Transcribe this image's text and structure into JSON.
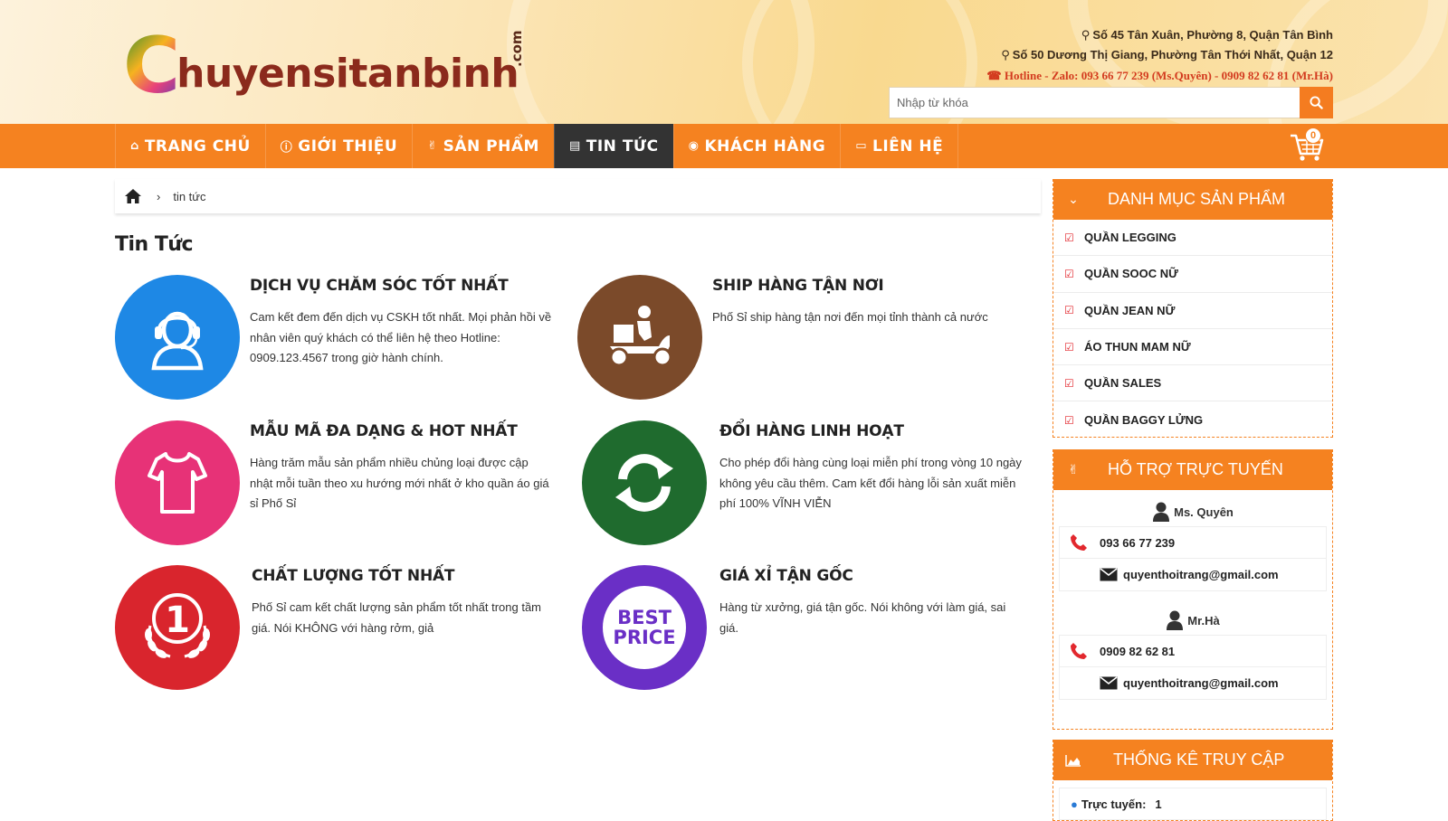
{
  "header": {
    "logo": {
      "letter": "C",
      "text": "huyensitanbinh",
      "tld": ".com"
    },
    "address_1": "Số 45 Tân Xuân, Phường 8, Quận Tân Bình",
    "address_2": "Số 50 Dương Thị Giang, Phường Tân Thới Nhất, Quận 12",
    "hotline": "Hotline - Zalo: 093 66 77 239 (Ms.Quyên) - 0909 82 62 81 (Mr.Hà)",
    "search": {
      "placeholder": "Nhập từ khóa",
      "value": ""
    }
  },
  "nav": {
    "items": [
      {
        "label": "TRANG CHỦ",
        "icon": "home-icon"
      },
      {
        "label": "GIỚI THIỆU",
        "icon": "info-icon"
      },
      {
        "label": "SẢN PHẨM",
        "icon": "hand-icon"
      },
      {
        "label": "TIN TỨC",
        "icon": "newspaper-icon",
        "active": true
      },
      {
        "label": "KHÁCH HÀNG",
        "icon": "circle-icon"
      },
      {
        "label": "LIÊN HỆ",
        "icon": "card-icon"
      }
    ],
    "cart_count": "0"
  },
  "breadcrumb": {
    "current": "tin tức"
  },
  "page_title": "Tin Tức",
  "features": [
    {
      "title": "DỊCH VỤ CHĂM SÓC TỐT NHẤT",
      "desc": "Cam kết đem đến dịch vụ CSKH tốt nhất. Mọi phản hồi về nhân viên quý khách có thể liên hệ theo Hotline: 0909.123.4567 trong giờ hành chính.",
      "color": "#1e88e5",
      "icon": "headset-icon"
    },
    {
      "title": "SHIP HÀNG TẬN NƠI",
      "desc": "Phố Sỉ ship hàng tận nơi đến mọi tỉnh thành cả nước",
      "color": "#7b4a2a",
      "icon": "scooter-icon"
    },
    {
      "title": "MẪU MÃ ĐA DẠNG & HOT NHẤT",
      "desc": "Hàng trăm mẫu sản phẩm nhiều chủng loại được cập nhật mỗi tuần theo xu hướng mới nhất ở kho quần áo giá sỉ Phố Sỉ",
      "color": "#e73277",
      "icon": "shirt-icon"
    },
    {
      "title": "ĐỔI HÀNG LINH HOẠT",
      "desc": "Cho phép đổi hàng cùng loại miễn phí trong vòng 10 ngày không yêu cầu thêm. Cam kết đổi hàng lỗi sản xuất miễn phí 100% VĨNH VIỄN",
      "color": "#1f6b2e",
      "icon": "refresh-icon"
    },
    {
      "title": "CHẤT LƯỢNG TỐT NHẤT",
      "desc": "Phố Sỉ cam kết chất lượng sản phẩm tốt nhất trong tầm giá. Nói KHÔNG với hàng rởm, giả",
      "color": "#d9252d",
      "icon": "medal-icon"
    },
    {
      "title": "GIÁ XỈ TẬN GỐC",
      "desc": "Hàng từ xưởng, giá tận gốc. Nói không với làm giá, sai giá.",
      "color": "#6a2fc6",
      "icon": "best-price-icon",
      "badge_1": "BEST",
      "badge_2": "PRICE"
    }
  ],
  "sidebar": {
    "categories": {
      "title": "DANH MỤC SẢN PHẨM",
      "items": [
        "QUẦN LEGGING",
        "QUẦN SOOC NỮ",
        "QUẦN JEAN NỮ",
        "ÁO THUN MAM NỮ",
        "QUẦN SALES",
        "QUẦN BAGGY LỬNG"
      ]
    },
    "support": {
      "title": "HỖ TRỢ TRỰC TUYẾN",
      "contacts": [
        {
          "name": "Ms. Quyên",
          "phone": "093 66 77 239",
          "email": "quyenthoitrang@gmail.com"
        },
        {
          "name": "Mr.Hà",
          "phone": "0909 82 62 81",
          "email": "quyenthoitrang@gmail.com"
        }
      ]
    },
    "stats": {
      "title": "THỐNG KÊ TRUY CẬP",
      "online_label": "Trực tuyến:",
      "online_count": "1"
    }
  }
}
